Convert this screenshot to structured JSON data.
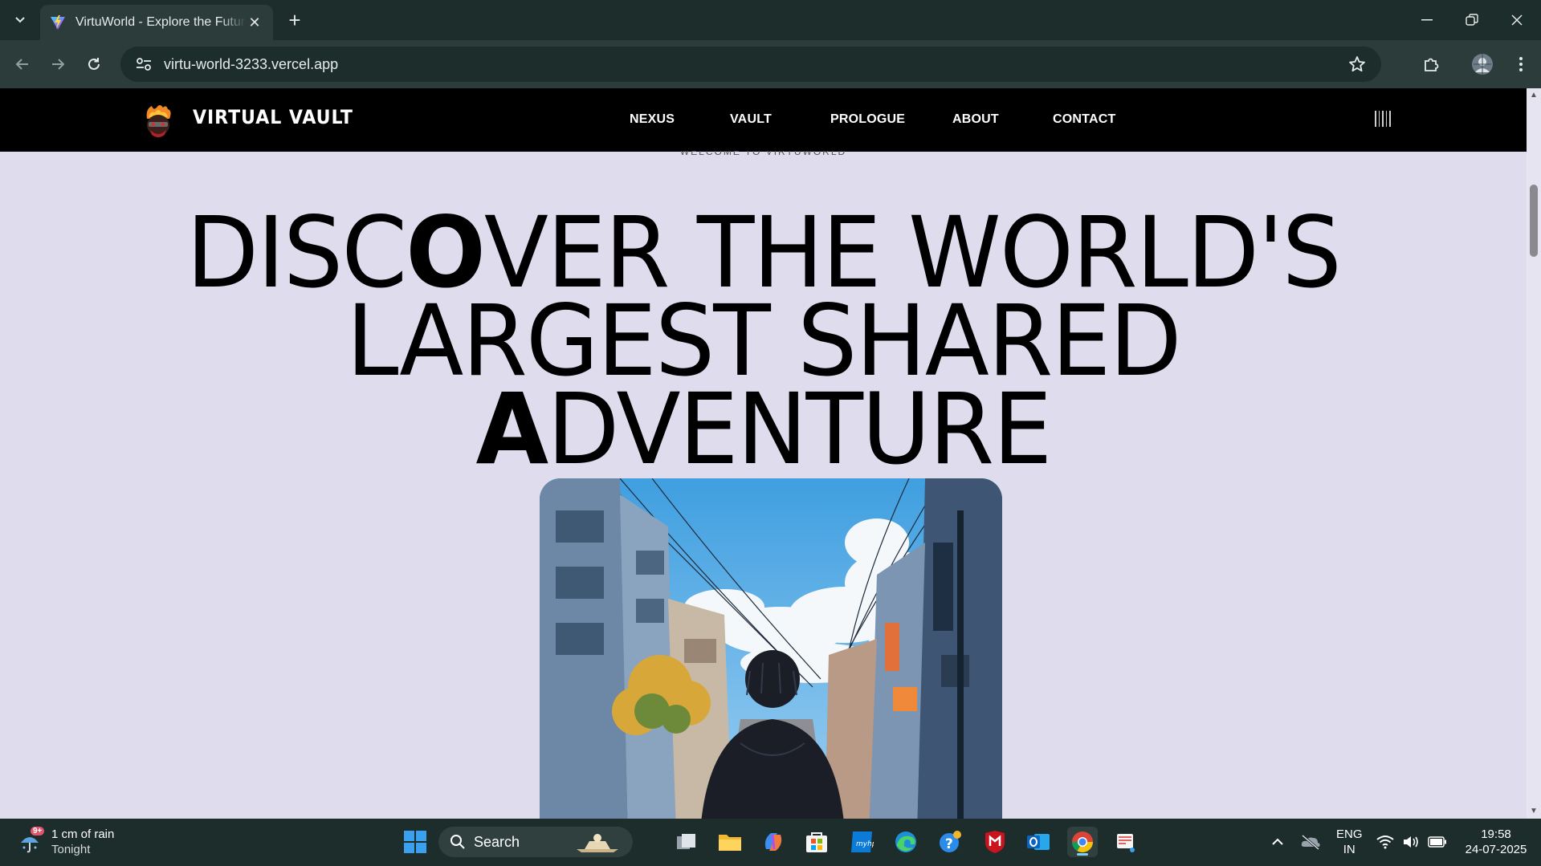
{
  "browser": {
    "tab_title": "VirtuWorld - Explore the Future",
    "url": "virtu-world-3233.vercel.app"
  },
  "site": {
    "brand": "VIRTUAL VAULT",
    "nav": [
      "NEXUS",
      "VAULT",
      "PROLOGUE",
      "ABOUT",
      "CONTACT"
    ],
    "welcome": "WELCOME TO VIRTUWORLD",
    "hero_lines": [
      {
        "pre": "DISC",
        "bold": "O",
        "post": "VER THE WORLD'S"
      },
      {
        "pre": "LARGEST SHARED",
        "bold": "",
        "post": ""
      },
      {
        "pre": "",
        "bold": "A",
        "post": "DVENTURE"
      }
    ]
  },
  "taskbar": {
    "weather_badge": "9+",
    "weather_main": "1 cm of rain",
    "weather_sub": "Tonight",
    "search_label": "Search",
    "lang_top": "ENG",
    "lang_bottom": "IN",
    "time": "19:58",
    "date": "24-07-2025"
  },
  "colors": {
    "page_bg": "#dfdded",
    "chrome_bg": "#1c2d2b",
    "toolbar_bg": "#2b3c3a",
    "nav_bg": "#000000"
  }
}
